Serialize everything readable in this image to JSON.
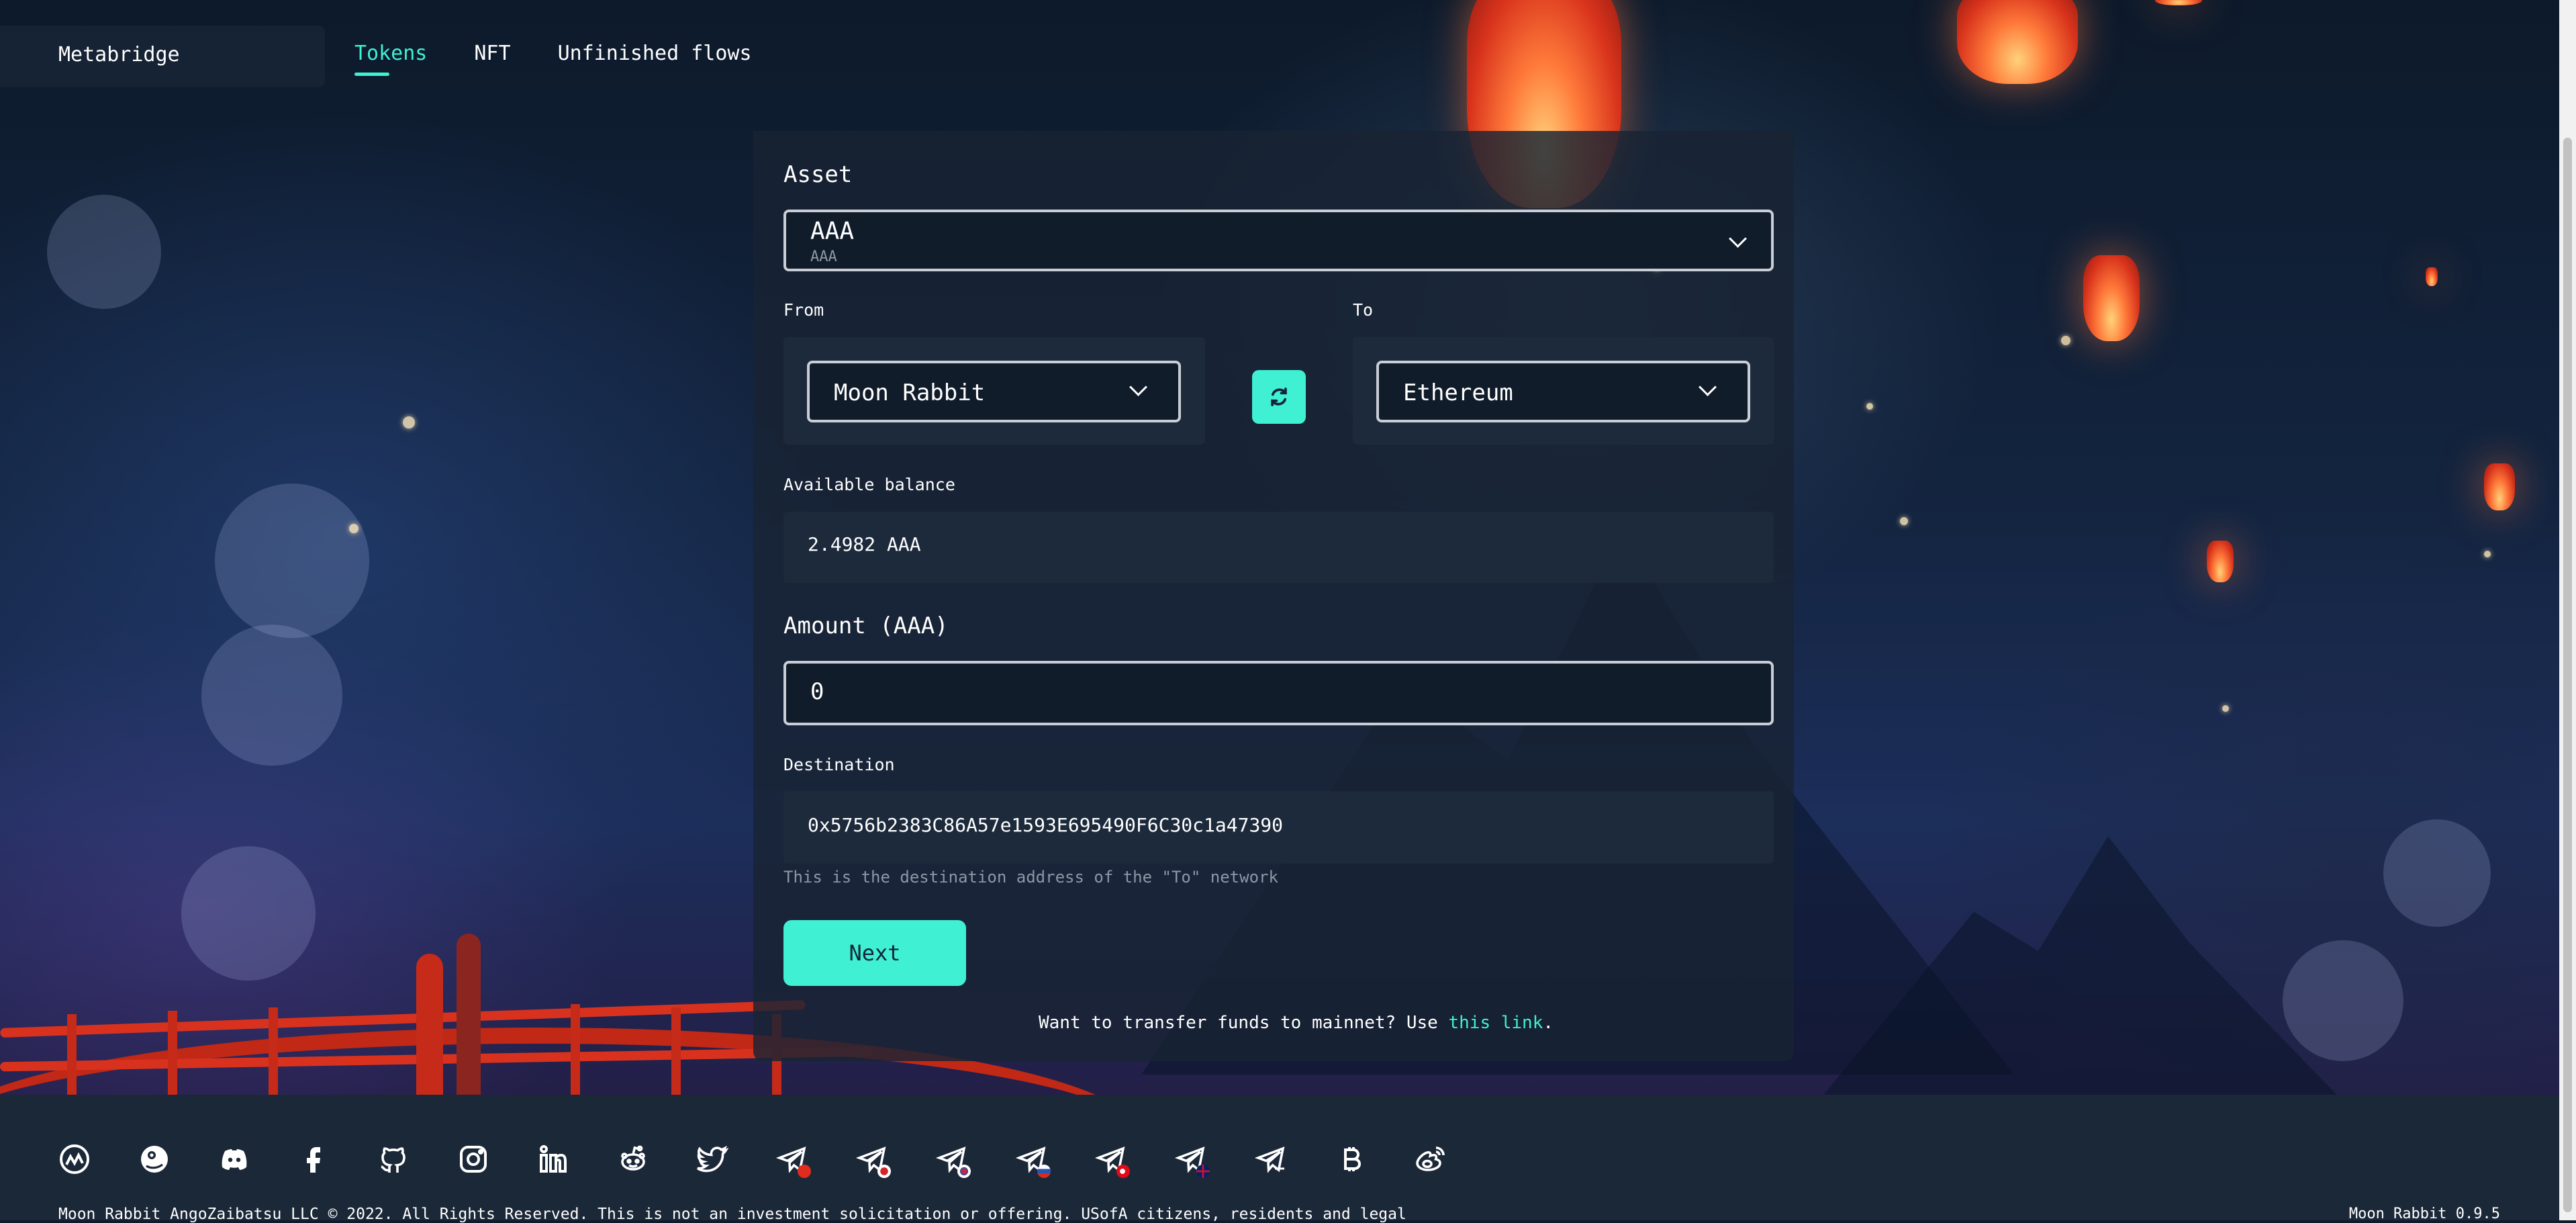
{
  "header": {
    "brand": "Metabridge",
    "tabs": [
      {
        "label": "Tokens",
        "active": true
      },
      {
        "label": "NFT",
        "active": false
      },
      {
        "label": "Unfinished flows",
        "active": false
      }
    ]
  },
  "form": {
    "asset": {
      "label": "Asset",
      "value": "AAA",
      "sub_value": "AAA"
    },
    "from": {
      "label": "From",
      "value": "Moon Rabbit"
    },
    "to": {
      "label": "To",
      "value": "Ethereum"
    },
    "balance": {
      "label": "Available balance",
      "value": "2.4982 AAA"
    },
    "amount": {
      "label": "Amount (AAA)",
      "value": "0"
    },
    "destination": {
      "label": "Destination",
      "value": "0x5756b2383C86A57e1593E695490F6C30c1a47390",
      "help": "This is the destination address of the \"To\" network"
    },
    "next_label": "Next",
    "mainnet_text": "Want to transfer funds to mainnet? Use ",
    "mainnet_link": "this link",
    "mainnet_suffix": "."
  },
  "footer": {
    "social_icons": [
      "coinmarketcap-icon",
      "coingecko-icon",
      "discord-icon",
      "facebook-icon",
      "github-icon",
      "instagram-icon",
      "linkedin-icon",
      "reddit-icon",
      "twitter-icon",
      "telegram-cn-icon",
      "telegram-jp-icon",
      "telegram-kr-icon",
      "telegram-ru-icon",
      "telegram-tr-icon",
      "telegram-uk-icon",
      "telegram-news-icon",
      "bitcoin-icon",
      "weibo-icon"
    ],
    "copyright": "Moon Rabbit AngoZaibatsu LLC © 2022. All Rights Reserved. This is not an investment solicitation or offering. USofA citizens, residents and legal",
    "version": "Moon Rabbit 0.9.5"
  },
  "colors": {
    "accent": "#3ff0d2",
    "card": "#182333",
    "field": "#1c2a3c",
    "footer": "#1b2838"
  }
}
